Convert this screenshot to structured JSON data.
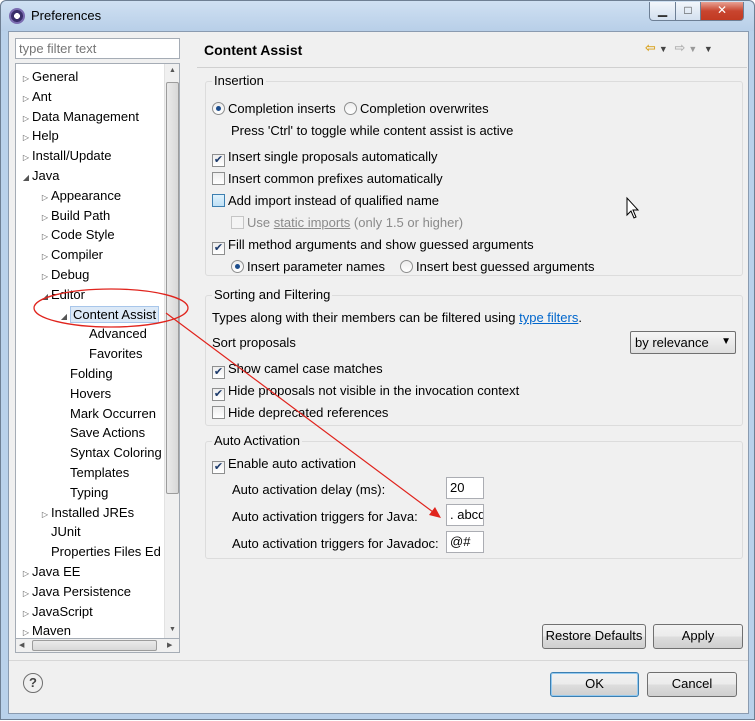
{
  "window": {
    "title": "Preferences",
    "minimize_label": "▁",
    "maximize_label": "□",
    "close_label": "✕"
  },
  "filter": {
    "placeholder": "type filter text"
  },
  "tree": {
    "items": [
      {
        "label": "General",
        "level": 0,
        "state": "collapsed"
      },
      {
        "label": "Ant",
        "level": 0,
        "state": "collapsed"
      },
      {
        "label": "Data Management",
        "level": 0,
        "state": "collapsed"
      },
      {
        "label": "Help",
        "level": 0,
        "state": "collapsed"
      },
      {
        "label": "Install/Update",
        "level": 0,
        "state": "collapsed"
      },
      {
        "label": "Java",
        "level": 0,
        "state": "expanded"
      },
      {
        "label": "Appearance",
        "level": 1,
        "state": "collapsed"
      },
      {
        "label": "Build Path",
        "level": 1,
        "state": "collapsed"
      },
      {
        "label": "Code Style",
        "level": 1,
        "state": "collapsed"
      },
      {
        "label": "Compiler",
        "level": 1,
        "state": "collapsed"
      },
      {
        "label": "Debug",
        "level": 1,
        "state": "collapsed"
      },
      {
        "label": "Editor",
        "level": 1,
        "state": "expanded"
      },
      {
        "label": "Content Assist",
        "level": 2,
        "state": "expanded",
        "selected": true
      },
      {
        "label": "Advanced",
        "level": 3,
        "state": "leaf"
      },
      {
        "label": "Favorites",
        "level": 3,
        "state": "leaf"
      },
      {
        "label": "Folding",
        "level": 2,
        "state": "leaf"
      },
      {
        "label": "Hovers",
        "level": 2,
        "state": "leaf"
      },
      {
        "label": "Mark Occurren",
        "level": 2,
        "state": "leaf"
      },
      {
        "label": "Save Actions",
        "level": 2,
        "state": "leaf"
      },
      {
        "label": "Syntax Coloring",
        "level": 2,
        "state": "leaf"
      },
      {
        "label": "Templates",
        "level": 2,
        "state": "leaf"
      },
      {
        "label": "Typing",
        "level": 2,
        "state": "leaf"
      },
      {
        "label": "Installed JREs",
        "level": 1,
        "state": "collapsed"
      },
      {
        "label": "JUnit",
        "level": 1,
        "state": "leaf"
      },
      {
        "label": "Properties Files Ed",
        "level": 1,
        "state": "leaf"
      },
      {
        "label": "Java EE",
        "level": 0,
        "state": "collapsed"
      },
      {
        "label": "Java Persistence",
        "level": 0,
        "state": "collapsed"
      },
      {
        "label": "JavaScript",
        "level": 0,
        "state": "collapsed"
      },
      {
        "label": "Maven",
        "level": 0,
        "state": "collapsed"
      }
    ]
  },
  "page": {
    "title": "Content Assist",
    "insertion": {
      "title": "Insertion",
      "completion_inserts": "Completion inserts",
      "completion_overwrites": "Completion overwrites",
      "toggle_hint": "Press 'Ctrl' to toggle while content assist is active",
      "insert_single": "Insert single proposals automatically",
      "insert_common": "Insert common prefixes automatically",
      "add_import": "Add import instead of qualified name",
      "use_prefix": "Use ",
      "static_imports": "static imports",
      "static_suffix": " (only 1.5 or higher)",
      "fill_method": "Fill method arguments and show guessed arguments",
      "insert_param_names": "Insert parameter names",
      "insert_best_guessed": "Insert best guessed arguments"
    },
    "sorting": {
      "title": "Sorting and Filtering",
      "types_text": "Types along with their members can be filtered using ",
      "type_filters": "type filters",
      "period": ".",
      "sort_proposals": "Sort proposals",
      "sort_value": "by relevance",
      "show_camel": "Show camel case matches",
      "hide_not_visible": "Hide proposals not visible in the invocation context",
      "hide_deprecated": "Hide deprecated references"
    },
    "auto_activation": {
      "title": "Auto Activation",
      "enable": "Enable auto activation",
      "delay_label": "Auto activation delay (ms):",
      "delay_value": "20",
      "java_label": "Auto activation triggers for Java:",
      "java_value": ". abcd",
      "javadoc_label": "Auto activation triggers for Javadoc:",
      "javadoc_value": "@#"
    },
    "buttons": {
      "restore_defaults": "Restore Defaults",
      "apply": "Apply"
    }
  },
  "dialog_buttons": {
    "ok": "OK",
    "cancel": "Cancel",
    "help": "?"
  },
  "checks": {
    "insert_single": true,
    "insert_common": false,
    "add_import": false,
    "use_static": false,
    "fill_method": true,
    "show_camel": true,
    "hide_not_visible": true,
    "hide_deprecated": false,
    "enable_auto": true
  },
  "colors": {
    "annotation": "#e0241d",
    "link": "#0066cc",
    "selection": "#dce9f7"
  }
}
